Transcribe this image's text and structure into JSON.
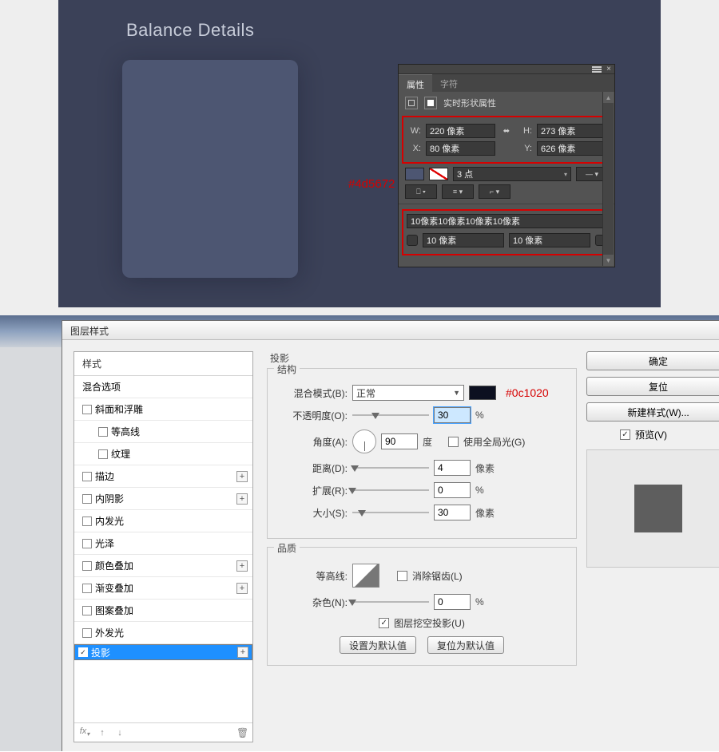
{
  "canvas": {
    "heading": "Balance Details",
    "swatch_label": "#4d5672"
  },
  "props": {
    "tabs": {
      "active": "属性",
      "inactive": "字符"
    },
    "title": "实时形状属性",
    "W_label": "W:",
    "W_value": "220 像素",
    "H_label": "H:",
    "H_value": "273 像素",
    "X_label": "X:",
    "X_value": "80 像素",
    "Y_label": "Y:",
    "Y_value": "626 像素",
    "stroke_pts": "3 点",
    "radii_all": "10像素10像素10像素10像素",
    "radius_a": "10 像素",
    "radius_b": "10 像素"
  },
  "dlg": {
    "title": "图层样式",
    "styles_header": "样式",
    "styles": [
      {
        "label": "混合选项",
        "chk": null
      },
      {
        "label": "斜面和浮雕",
        "chk": false
      },
      {
        "label": "等高线",
        "chk": false,
        "indent": true
      },
      {
        "label": "纹理",
        "chk": false,
        "indent": true
      },
      {
        "label": "描边",
        "chk": false,
        "add": true
      },
      {
        "label": "内阴影",
        "chk": false,
        "add": true
      },
      {
        "label": "内发光",
        "chk": false
      },
      {
        "label": "光泽",
        "chk": false
      },
      {
        "label": "颜色叠加",
        "chk": false,
        "add": true
      },
      {
        "label": "渐变叠加",
        "chk": false,
        "add": true
      },
      {
        "label": "图案叠加",
        "chk": false
      },
      {
        "label": "外发光",
        "chk": false
      },
      {
        "label": "投影",
        "chk": true,
        "add": true,
        "sel": true
      }
    ],
    "section_title": "投影",
    "structure_legend": "结构",
    "quality_legend": "品质",
    "blend_label": "混合模式(B):",
    "blend_value": "正常",
    "shadow_hex": "#0c1020",
    "opacity_label": "不透明度(O):",
    "opacity_value": "30",
    "pct": "%",
    "angle_label": "角度(A):",
    "angle_value": "90",
    "deg": "度",
    "global_light": "使用全局光(G)",
    "distance_label": "距离(D):",
    "distance_value": "4",
    "px": "像素",
    "spread_label": "扩展(R):",
    "spread_value": "0",
    "size_label": "大小(S):",
    "size_value": "30",
    "contour_label": "等高线:",
    "antialias": "消除锯齿(L)",
    "noise_label": "杂色(N):",
    "noise_value": "0",
    "knockout": "图层挖空投影(U)",
    "set_default": "设置为默认值",
    "reset_default": "复位为默认值",
    "ok": "确定",
    "cancel": "复位",
    "new_style": "新建样式(W)...",
    "preview": "预览(V)"
  },
  "colors": {
    "card": "#4d5672",
    "shadow": "#0c1020"
  }
}
